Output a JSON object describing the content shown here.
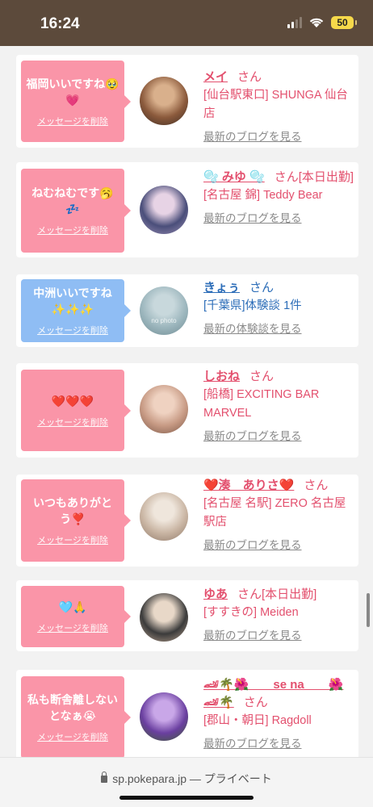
{
  "status_bar": {
    "time": "16:24",
    "battery": "50"
  },
  "url_bar": {
    "domain": "sp.pokepara.jp",
    "mode": "— プライベート"
  },
  "delete_label": "メッセージを削除",
  "items": [
    {
      "message": "福岡いいですね🥹💗",
      "bubble_color": "pink",
      "name": "メイ",
      "suffix": "さん",
      "shop": "[仙台駅東口] SHUNGA 仙台店",
      "link": "最新のブログを見る",
      "avatar_colors": [
        "#8b5a3c",
        "#d9b08c",
        "#3b2a22"
      ]
    },
    {
      "message": "ねむねむです🥱💤",
      "bubble_color": "pink",
      "name": "🫧 みゆ 🫧",
      "suffix": "さん[本日出勤]",
      "shop": "[名古屋 錦] Teddy Bear",
      "link": "最新のブログを見る",
      "avatar_colors": [
        "#4a4e7a",
        "#e7d3e5",
        "#9b8fb4"
      ]
    },
    {
      "message": "中洲いいですね✨✨✨",
      "bubble_color": "blue",
      "name": "きょぅ",
      "suffix": "さん",
      "shop": "[千葉県]体験談 1件",
      "link": "最新の体験談を見る",
      "avatar_colors": [
        "#9cb6bd",
        "#c8d8dc",
        "#6f8b93"
      ],
      "no_photo": "no photo"
    },
    {
      "message": "❤️❤️❤️",
      "bubble_color": "pink",
      "name": "しおね",
      "suffix": "さん",
      "shop": "[船橋] EXCITING BAR MARVEL",
      "link": "最新のブログを見る",
      "avatar_colors": [
        "#c79a84",
        "#efd2c1",
        "#7a5646"
      ]
    },
    {
      "message": "いつもありがとう❣️",
      "bubble_color": "pink",
      "name": "❤️湊　ありさ❤️",
      "suffix": "さん",
      "shop": "[名古屋 名駅] ZERO 名古屋駅店",
      "link": "最新のブログを見る",
      "avatar_colors": [
        "#c9b5a3",
        "#efe6dc",
        "#8e7767"
      ]
    },
    {
      "message": "🩵🙏",
      "bubble_color": "pink",
      "name": "ゆあ",
      "suffix": "さん[本日出勤]",
      "shop": "[すすきの] Meiden",
      "link": "最新のブログを見る",
      "avatar_colors": [
        "#3b3b3b",
        "#e8d8c8",
        "#b9a28f"
      ]
    },
    {
      "message": "私も断舎離しないとなぁ😭",
      "bubble_color": "pink",
      "name": "🏎🌴🌺　　se na　　🌺🏎🌴",
      "suffix": "さん",
      "shop": "[郡山・朝日] Ragdoll",
      "link": "最新のブログを見る",
      "avatar_colors": [
        "#6a3fa0",
        "#c9a7e8",
        "#3a5f2a"
      ]
    }
  ]
}
